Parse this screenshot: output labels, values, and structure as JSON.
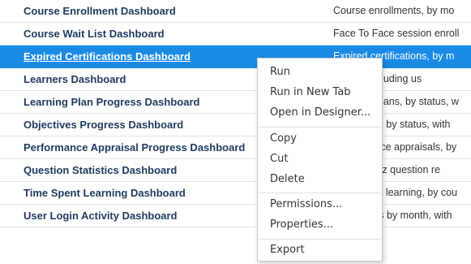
{
  "rows": [
    {
      "name": "Course Enrollment Dashboard",
      "desc": "Course enrollments, by mo"
    },
    {
      "name": "Course Wait List Dashboard",
      "desc": "Face To Face session enroll"
    },
    {
      "name": "Expired Certifications Dashboard",
      "desc": "Expired certifications, by m"
    },
    {
      "name": "Learners Dashboard",
      "desc": "Activity including us"
    },
    {
      "name": "Learning Plan Progress Dashboard",
      "desc": "Learning plans, by status, w"
    },
    {
      "name": "Objectives Progress Dashboard",
      "desc": "Objectives, by status, with"
    },
    {
      "name": "Performance Appraisal Progress Dashboard",
      "desc": "Performance appraisals, by"
    },
    {
      "name": "Question Statistics Dashboard",
      "desc": "Course quiz question re"
    },
    {
      "name": "Time Spent Learning Dashboard",
      "desc": "Time spent learning, by cou"
    },
    {
      "name": "User Login Activity Dashboard",
      "desc": "User logins by month, with"
    }
  ],
  "selected_row": "Expired Certifications Dashboard",
  "context_menu": {
    "run": "Run",
    "run_new_tab": "Run in New Tab",
    "open_designer": "Open in Designer...",
    "copy": "Copy",
    "cut": "Cut",
    "delete": "Delete",
    "permissions": "Permissions...",
    "properties": "Properties...",
    "export": "Export"
  }
}
